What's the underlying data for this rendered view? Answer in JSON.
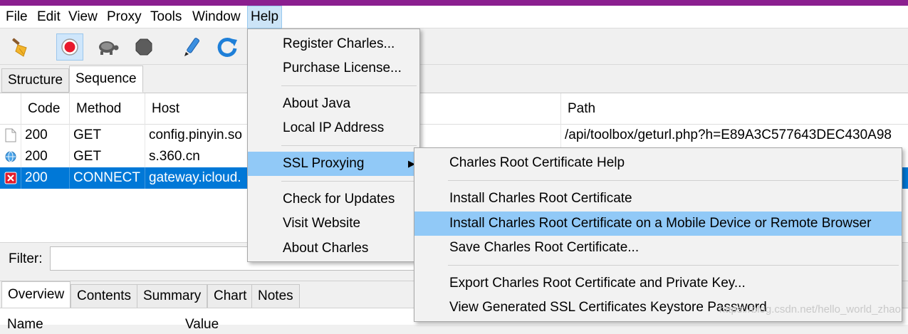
{
  "menubar": {
    "items": [
      "File",
      "Edit",
      "View",
      "Proxy",
      "Tools",
      "Window",
      "Help"
    ],
    "active": "Help"
  },
  "toolbar": {
    "icons": [
      "broom-icon",
      "record-icon",
      "turtle-icon",
      "stop-icon",
      "pen-icon",
      "refresh-icon"
    ],
    "recording": true
  },
  "view_tabs": {
    "structure": "Structure",
    "sequence": "Sequence",
    "selected": "Sequence"
  },
  "table": {
    "columns": {
      "code": "Code",
      "method": "Method",
      "host": "Host",
      "path": "Path"
    },
    "rows": [
      {
        "icon": "document-icon",
        "code": "200",
        "method": "GET",
        "host": "config.pinyin.so",
        "path": "/api/toolbox/geturl.php?h=E89A3C577643DEC430A98"
      },
      {
        "icon": "globe-icon",
        "code": "200",
        "method": "GET",
        "host": "s.360.cn",
        "path": ""
      },
      {
        "icon": "error-icon",
        "code": "200",
        "method": "CONNECT",
        "host": "gateway.icloud.",
        "path": "",
        "selected": true
      }
    ]
  },
  "filter": {
    "label": "Filter:",
    "value": ""
  },
  "detail_tabs": [
    "Overview",
    "Contents",
    "Summary",
    "Chart",
    "Notes"
  ],
  "detail_table": {
    "name_header": "Name",
    "value_header": "Value"
  },
  "help_menu": {
    "register": "Register Charles...",
    "purchase": "Purchase License...",
    "about_java": "About Java",
    "local_ip": "Local IP Address",
    "ssl_proxying": "SSL Proxying",
    "check_updates": "Check for Updates",
    "visit_website": "Visit Website",
    "about_charles": "About Charles"
  },
  "ssl_submenu": {
    "root_help": "Charles Root Certificate Help",
    "install_root": "Install Charles Root Certificate",
    "install_mobile": "Install Charles Root Certificate on a Mobile Device or Remote Browser",
    "save_root": "Save Charles Root Certificate...",
    "export_key": "Export Charles Root Certificate and Private Key...",
    "view_keystore": "View Generated SSL Certificates Keystore Password"
  },
  "watermark": "https://blog.csdn.net/hello_world_zhao",
  "colors": {
    "title_strip": "#8b1f8f",
    "selection": "#0078d7",
    "menu_highlight": "#91c9f7"
  }
}
